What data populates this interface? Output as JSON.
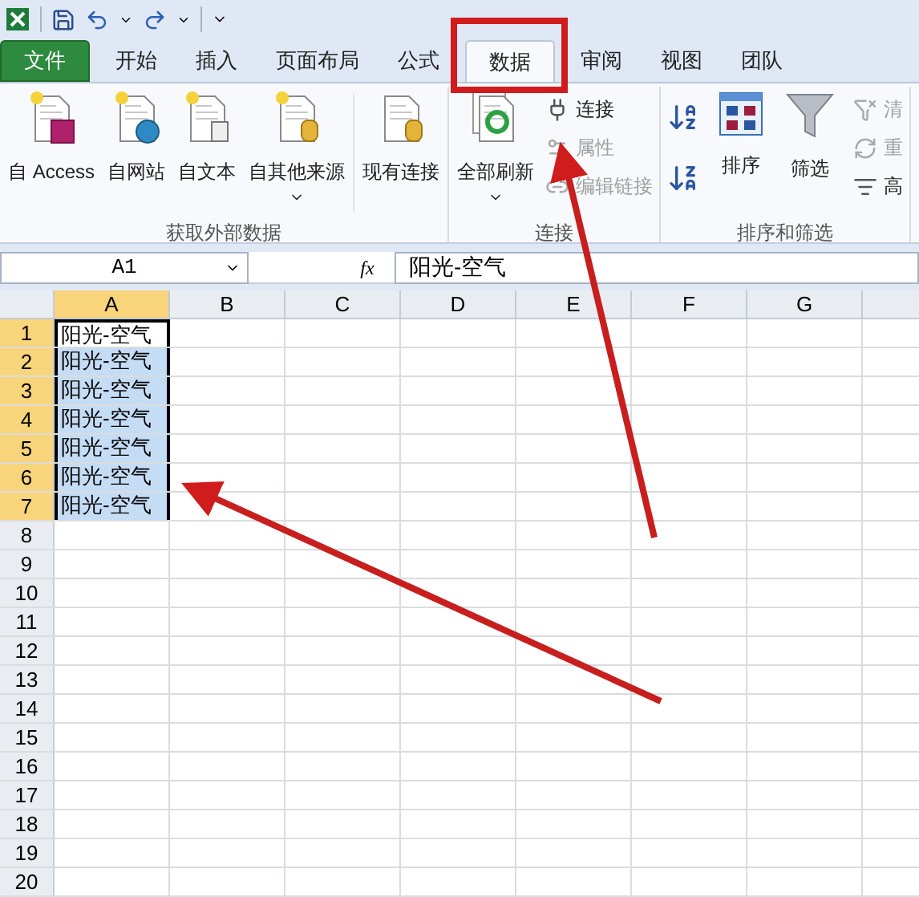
{
  "tabs": [
    {
      "label": "文件",
      "kind": "file",
      "selected": false
    },
    {
      "label": "开始",
      "kind": "normal",
      "selected": false
    },
    {
      "label": "插入",
      "kind": "normal",
      "selected": false
    },
    {
      "label": "页面布局",
      "kind": "normal",
      "selected": false
    },
    {
      "label": "公式",
      "kind": "normal",
      "selected": false
    },
    {
      "label": "数据",
      "kind": "normal",
      "selected": true
    },
    {
      "label": "审阅",
      "kind": "normal",
      "selected": false
    },
    {
      "label": "视图",
      "kind": "normal",
      "selected": false
    },
    {
      "label": "团队",
      "kind": "normal",
      "selected": false
    }
  ],
  "ribbon": {
    "groups": [
      {
        "label": "获取外部数据",
        "buttons": [
          {
            "kind": "large",
            "label": "自 Access",
            "disabled": false
          },
          {
            "kind": "large",
            "label": "自网站",
            "disabled": false
          },
          {
            "kind": "large",
            "label": "自文本",
            "disabled": false
          },
          {
            "kind": "large",
            "label": "自其他来源",
            "disabled": false,
            "dropdown": true
          },
          {
            "kind": "large",
            "label": "现有连接",
            "disabled": false
          }
        ]
      },
      {
        "label": "连接",
        "buttons": [
          {
            "kind": "large",
            "label": "全部刷新",
            "disabled": false,
            "dropdown": true
          },
          {
            "kind": "small",
            "label": "连接",
            "disabled": false
          },
          {
            "kind": "small",
            "label": "属性",
            "disabled": true
          },
          {
            "kind": "small",
            "label": "编辑链接",
            "disabled": true
          }
        ]
      },
      {
        "label": "排序和筛选",
        "buttons": [
          {
            "kind": "icon",
            "disabled": false
          },
          {
            "kind": "icon",
            "disabled": false
          },
          {
            "kind": "large",
            "label": "排序",
            "disabled": false
          },
          {
            "kind": "large",
            "label": "筛选",
            "disabled": false
          },
          {
            "kind": "small",
            "label": "清",
            "disabled": true
          },
          {
            "kind": "small",
            "label": "重",
            "disabled": true
          },
          {
            "kind": "small",
            "label": "高",
            "disabled": false
          }
        ]
      }
    ]
  },
  "formula_bar": {
    "name_box": "A1",
    "fx": "fx",
    "content": "阳光-空气"
  },
  "sheet": {
    "columns": [
      "A",
      "B",
      "C",
      "D",
      "E",
      "F",
      "G"
    ],
    "rows": [
      {
        "header": "1",
        "cells": [
          {
            "text": "阳光-空气",
            "selected": true,
            "active": true
          }
        ]
      },
      {
        "header": "2",
        "cells": [
          {
            "text": "阳光-空气",
            "selected": true,
            "active": false
          }
        ]
      },
      {
        "header": "3",
        "cells": [
          {
            "text": "阳光-空气",
            "selected": true,
            "active": false
          }
        ]
      },
      {
        "header": "4",
        "cells": [
          {
            "text": "阳光-空气",
            "selected": true,
            "active": false
          }
        ]
      },
      {
        "header": "5",
        "cells": [
          {
            "text": "阳光-空气",
            "selected": true,
            "active": false
          }
        ]
      },
      {
        "header": "6",
        "cells": [
          {
            "text": "阳光-空气",
            "selected": true,
            "active": false
          }
        ]
      },
      {
        "header": "7",
        "cells": [
          {
            "text": "阳光-空气",
            "selected": true,
            "active": false
          }
        ]
      },
      {
        "header": "8"
      },
      {
        "header": "9"
      },
      {
        "header": "10"
      },
      {
        "header": "11"
      },
      {
        "header": "12"
      },
      {
        "header": "13"
      },
      {
        "header": "14"
      },
      {
        "header": "15"
      },
      {
        "header": "16"
      },
      {
        "header": "17"
      },
      {
        "header": "18"
      },
      {
        "header": "19"
      },
      {
        "header": "20"
      }
    ]
  }
}
